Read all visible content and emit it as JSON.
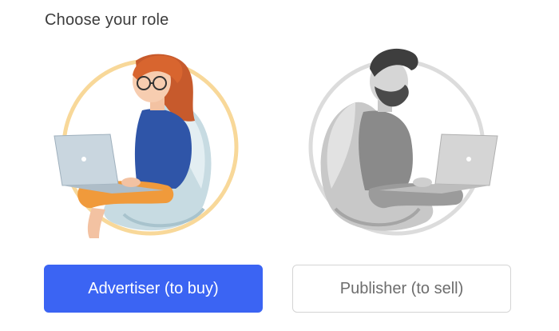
{
  "page": {
    "title": "Choose your role"
  },
  "roles": [
    {
      "id": "advertiser",
      "label": "Advertiser (to buy)",
      "selected": true,
      "illustration": "woman-in-egg-chair-with-laptop-illustration",
      "colors": {
        "button_bg": "#3b64f3",
        "button_text": "#ffffff",
        "ring": "#f8d899"
      }
    },
    {
      "id": "publisher",
      "label": "Publisher (to sell)",
      "selected": false,
      "illustration": "man-in-egg-chair-with-laptop-illustration",
      "colors": {
        "button_bg": "#ffffff",
        "button_text": "#6d6d6d",
        "button_border": "#d4d4d4",
        "ring": "#dcdcdc"
      }
    }
  ]
}
